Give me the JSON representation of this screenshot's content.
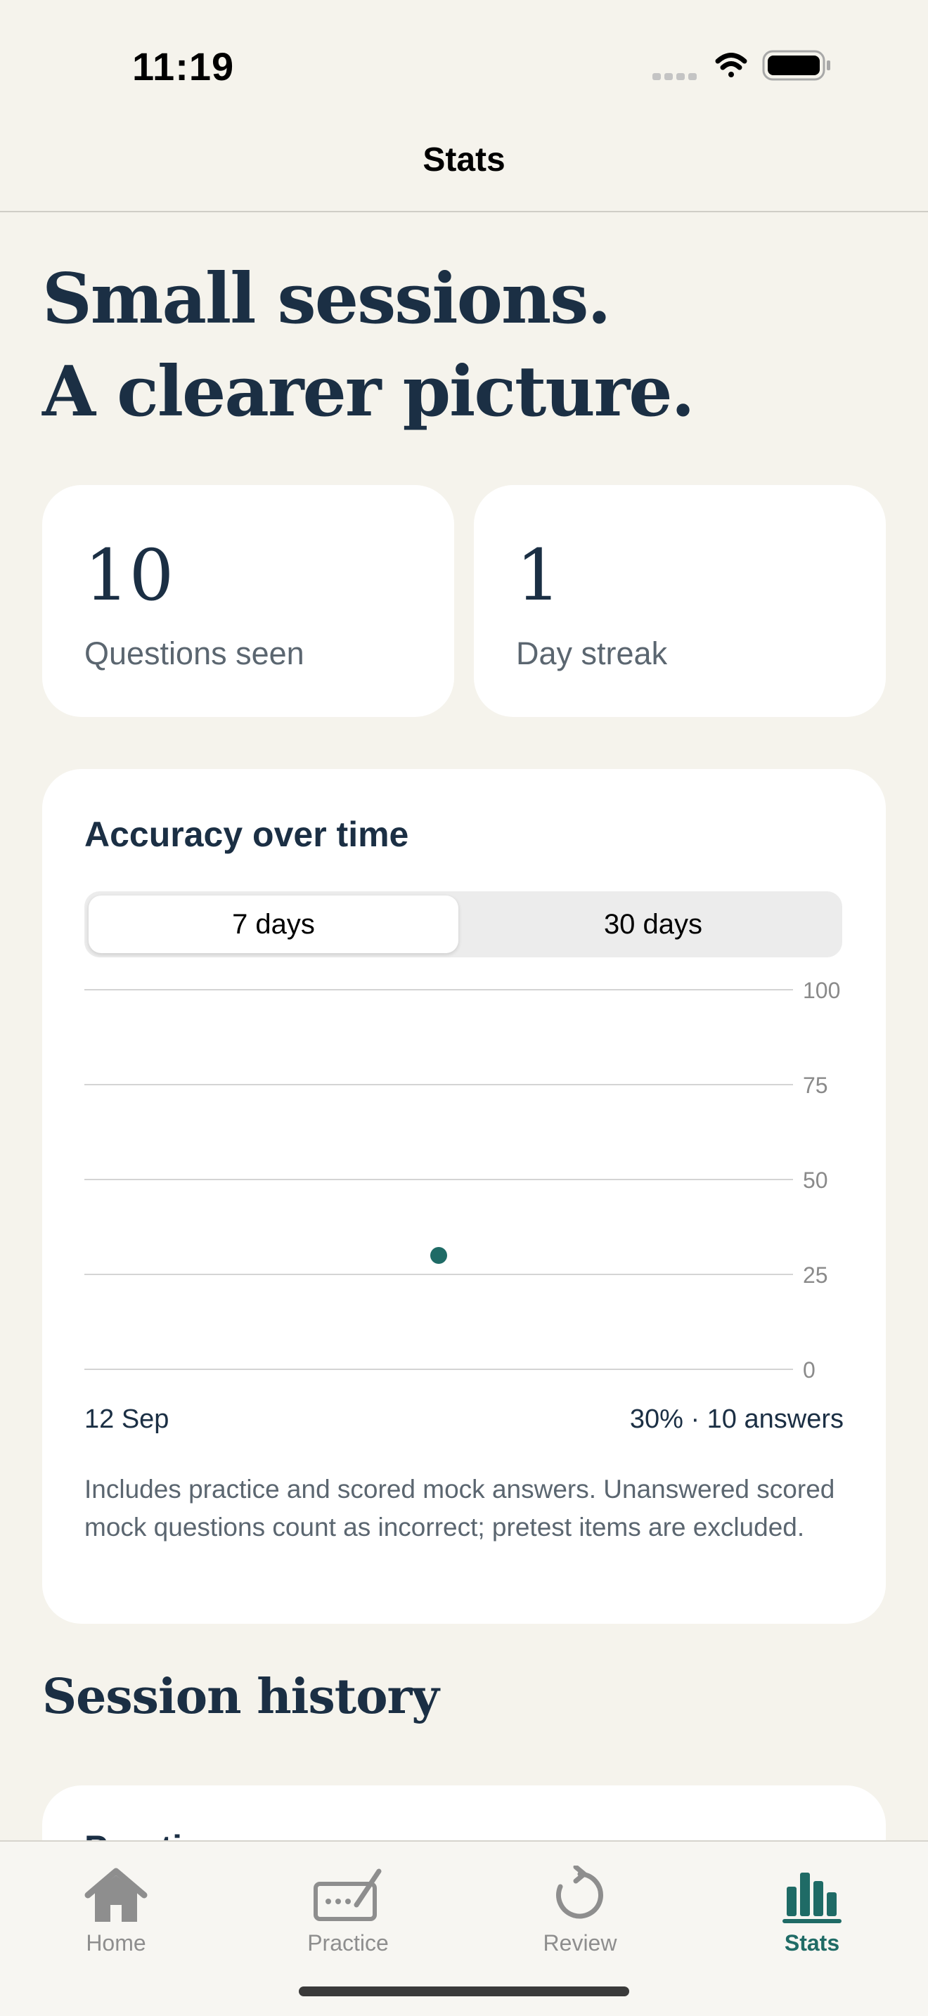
{
  "status_bar": {
    "time": "11:19",
    "icons": [
      "signal-icon",
      "wifi-icon",
      "battery-icon"
    ]
  },
  "nav": {
    "title": "Stats"
  },
  "hero": {
    "line1": "Small sessions.",
    "line2": "A clearer picture."
  },
  "stats": [
    {
      "value": "10",
      "label": "Questions seen"
    },
    {
      "value": "1",
      "label": "Day streak"
    }
  ],
  "accuracy": {
    "title": "Accuracy over time",
    "segments": [
      {
        "label": "7 days",
        "selected": true
      },
      {
        "label": "30 days",
        "selected": false
      }
    ],
    "x_label": "12 Sep",
    "summary": "30% · 10 answers",
    "note": "Includes practice and scored mock answers. Unanswered scored mock questions count as incorrect; pretest items are excluded."
  },
  "chart_data": {
    "type": "scatter",
    "ylim": [
      0,
      100
    ],
    "y_ticks": [
      "100",
      "75",
      "50",
      "25",
      "0"
    ],
    "grid": true,
    "points": [
      {
        "x": "12 Sep",
        "y": 30
      }
    ],
    "color": "#1f6b66"
  },
  "session_history": {
    "title": "Session history",
    "first_card_label": "Practice"
  },
  "tab_bar": {
    "items": [
      {
        "label": "Home",
        "icon": "home-icon",
        "active": false
      },
      {
        "label": "Practice",
        "icon": "practice-icon",
        "active": false
      },
      {
        "label": "Review",
        "icon": "review-icon",
        "active": false
      },
      {
        "label": "Stats",
        "icon": "stats-icon",
        "active": true
      }
    ]
  },
  "colors": {
    "accent": "#1f6b66",
    "background": "#f5f3ec",
    "text": "#1b2f44"
  }
}
